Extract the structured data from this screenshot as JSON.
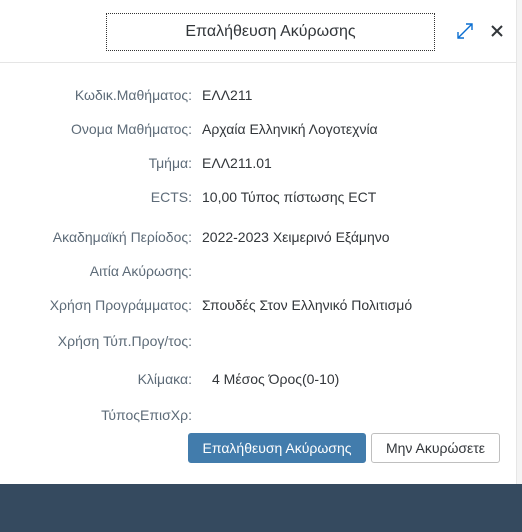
{
  "dialog": {
    "title": "Επαλήθευση Ακύρωσης"
  },
  "fields": [
    {
      "label": "Κωδικ.Μαθήματος:",
      "value": "ΕΛΛ211"
    },
    {
      "label": "Ονομα Μαθήματος:",
      "value": "Αρχαία Ελληνική Λογοτεχνία"
    },
    {
      "label": "Τμήμα:",
      "value": "ΕΛΛ211.01"
    },
    {
      "label": "ECTS:",
      "value": "10,00 Τύπος πίστωσης ECT"
    },
    {
      "label": "Ακαδημαϊκή Περίοδος:",
      "value": "2022-2023 Χειμερινό Εξάμηνο"
    },
    {
      "label": "Αιτία Ακύρωσης:",
      "value": ""
    },
    {
      "label": "Χρήση Προγράμματος:",
      "value": "Σπουδές Στον Ελληνικό Πολιτισμό"
    },
    {
      "label": "Χρήση Τύπ.Προγ/τος:",
      "value": ""
    },
    {
      "label": "Κλίμακα:",
      "value": "4 Μέσος Όρος(0-10)"
    },
    {
      "label": "ΤύποςΕπισΧρ:",
      "value": ""
    }
  ],
  "buttons": {
    "confirm": "Επαλήθευση Ακύρωσης",
    "cancel": "Μην Ακυρώσετε"
  },
  "icons": {
    "expand": "expand-icon",
    "close": "close-icon"
  },
  "colors": {
    "primary_button": "#427cac",
    "footer": "#354a5f",
    "label": "#5d6b78",
    "text": "#32363a"
  }
}
